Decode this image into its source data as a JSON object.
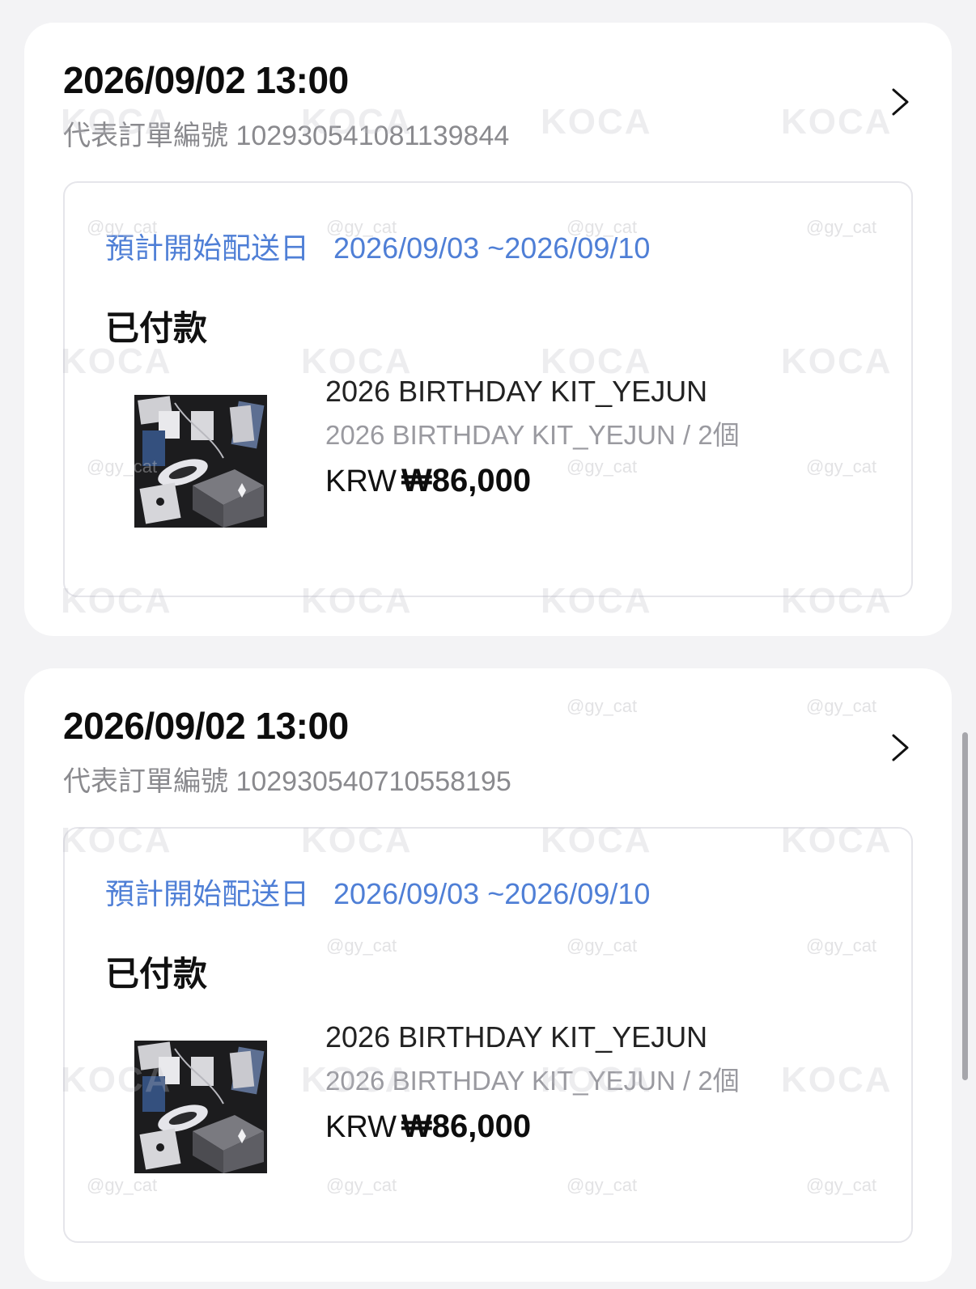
{
  "orders": [
    {
      "datetime": "2026/09/02 13:00",
      "order_number_label": "代表訂單編號 102930541081139844",
      "shipping_label": "預計開始配送日",
      "shipping_range": "2026/09/03 ~2026/09/10",
      "status": "已付款",
      "item": {
        "name": "2026 BIRTHDAY KIT_YEJUN",
        "option": "2026 BIRTHDAY KIT_YEJUN / 2個",
        "currency": "KRW",
        "price": "₩86,000"
      }
    },
    {
      "datetime": "2026/09/02 13:00",
      "order_number_label": "代表訂單編號 102930540710558195",
      "shipping_label": "預計開始配送日",
      "shipping_range": "2026/09/03 ~2026/09/10",
      "status": "已付款",
      "item": {
        "name": "2026 BIRTHDAY KIT_YEJUN",
        "option": "2026 BIRTHDAY KIT_YEJUN / 2個",
        "currency": "KRW",
        "price": "₩86,000"
      }
    }
  ],
  "watermarks": {
    "brand": "KOCA",
    "handle": "@gy_cat"
  },
  "icons": {
    "order_detail": "chevron-right-icon",
    "product_image": "product-thumbnail"
  },
  "colors": {
    "page_background": "#f3f3f5",
    "card_background": "#ffffff",
    "shipping_text": "#4f7fd6",
    "secondary_text": "#8a8a8e"
  }
}
